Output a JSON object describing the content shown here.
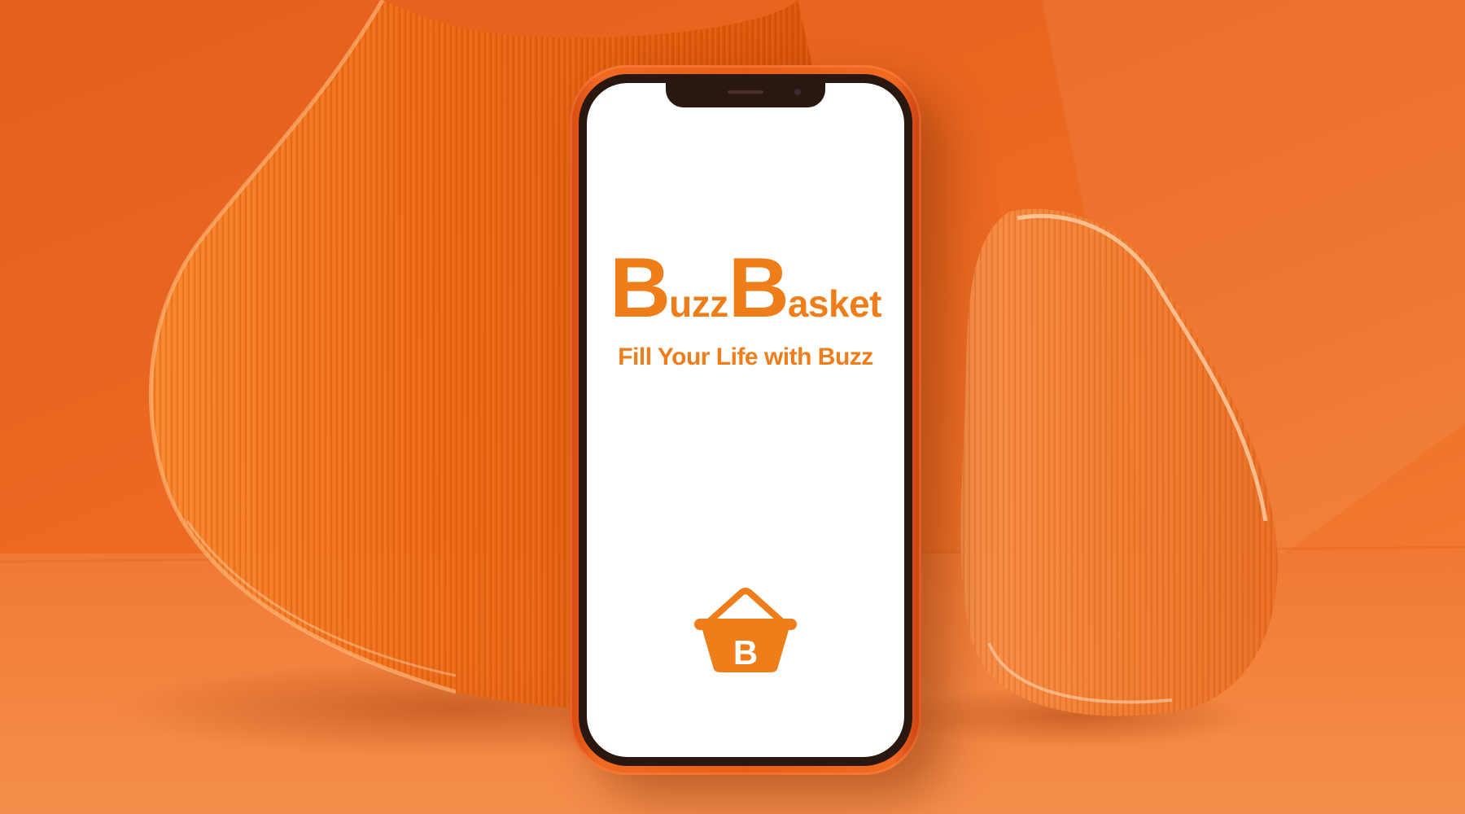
{
  "colors": {
    "background": "#e8621c",
    "phone_case": "#ea5d17",
    "brand_orange": "#ef7d1a",
    "screen": "#ffffff"
  },
  "screen": {
    "brand_first": "Buzz",
    "brand_second": "Basket",
    "tagline": "Fill Your Life with Buzz",
    "logo_icon": "basket-icon",
    "logo_letter": "B"
  }
}
